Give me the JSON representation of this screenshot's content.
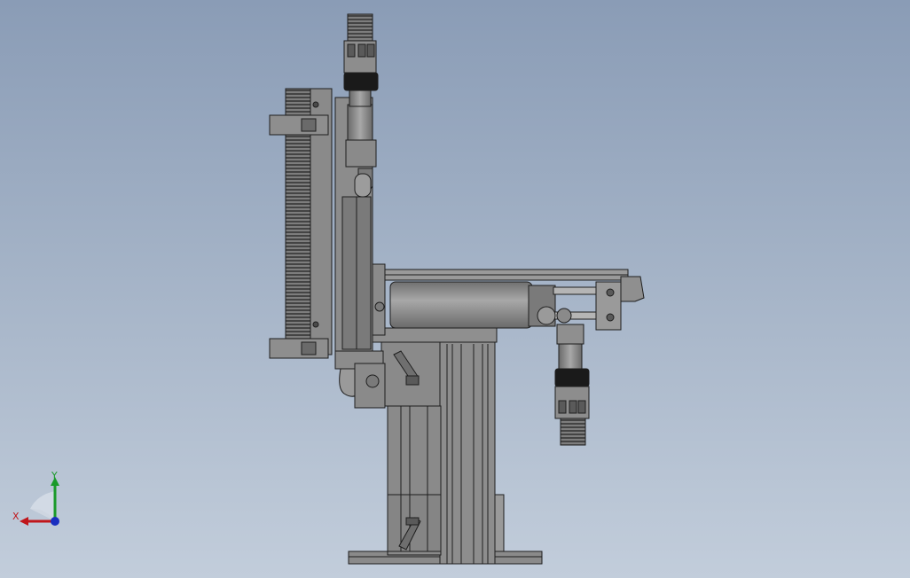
{
  "colors": {
    "background_top": "#8a9cb6",
    "background_bottom": "#c2cddb",
    "part_fill": "#8c8c8c",
    "part_dark": "#4a4a4a",
    "part_light": "#b0b0b0",
    "edge": "#1e1e1e",
    "x_axis": "#c0161b",
    "y_axis": "#1a9a2a",
    "z_axis": "#1a2fc0"
  },
  "triad": {
    "x_label": "X",
    "y_label": "Y"
  },
  "icons": {
    "triad": "coordinate-triad-icon"
  }
}
